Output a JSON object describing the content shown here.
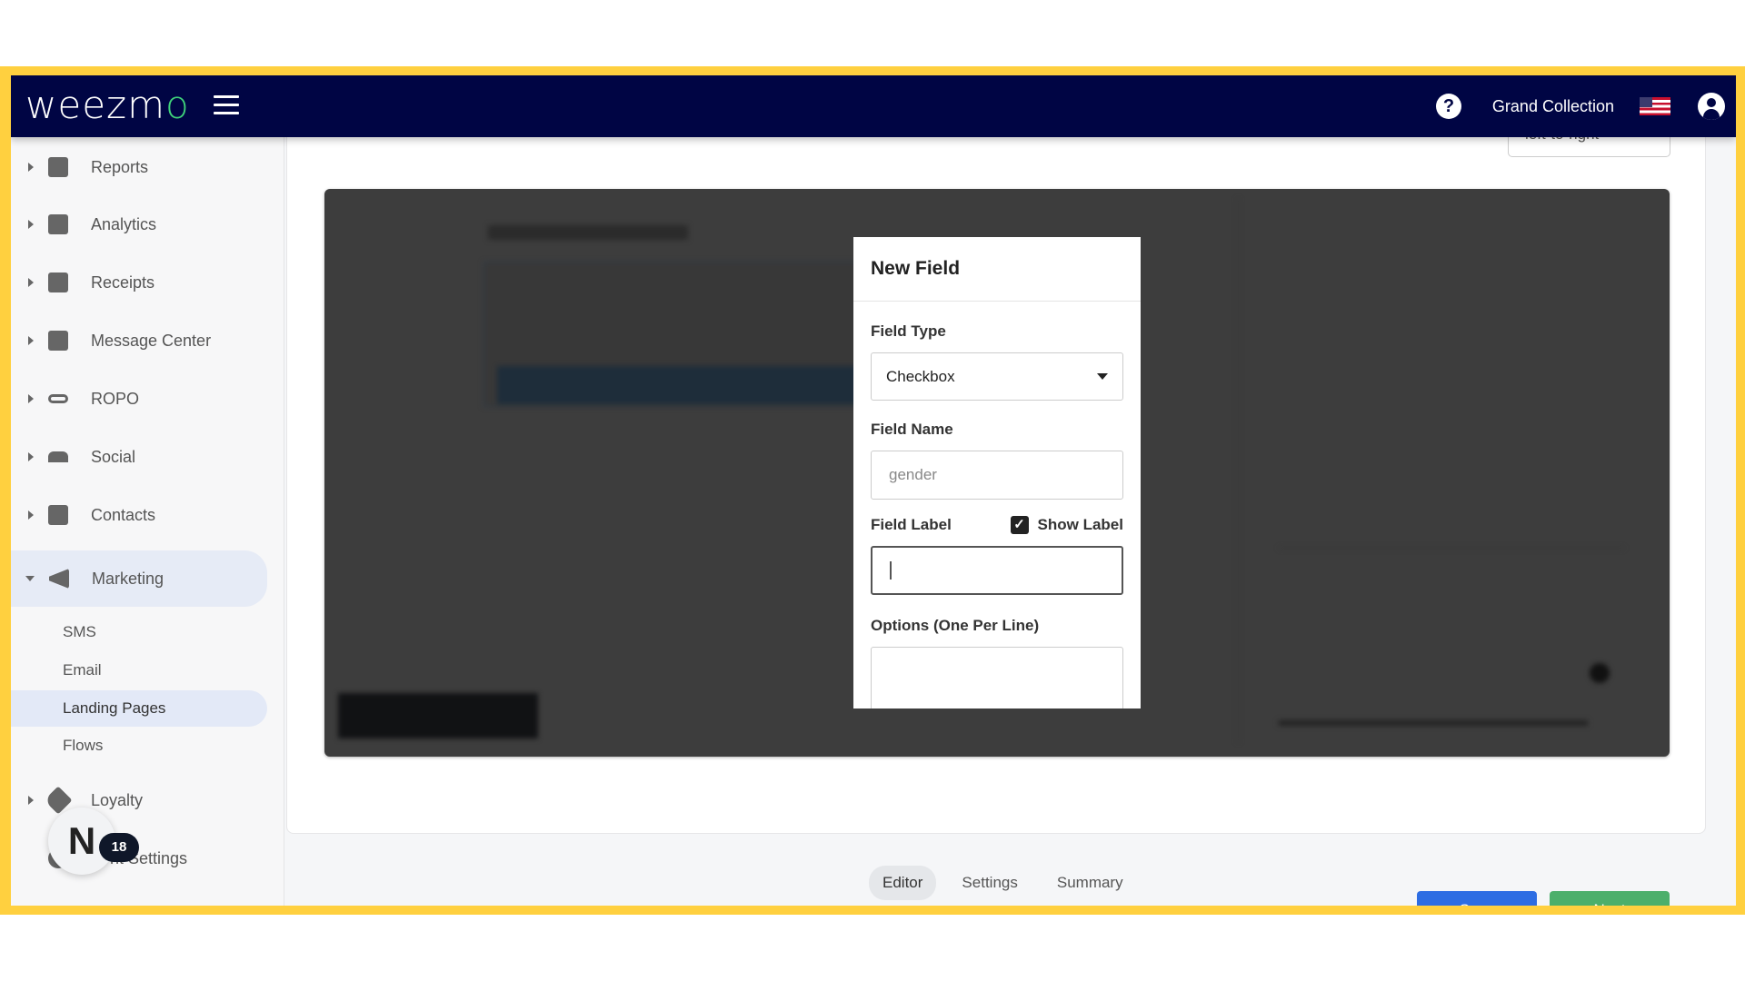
{
  "header": {
    "logo": "weezmo",
    "brand": "Grand Collection",
    "icons": [
      "menu-icon",
      "help-icon",
      "us-flag-icon",
      "user-icon"
    ]
  },
  "sidebar": {
    "items": [
      {
        "label": "Reports",
        "icon": "dashboard-icon"
      },
      {
        "label": "Analytics",
        "icon": "bar-chart-icon"
      },
      {
        "label": "Receipts",
        "icon": "receipt-icon"
      },
      {
        "label": "Message Center",
        "icon": "message-icon"
      },
      {
        "label": "ROPO",
        "icon": "infinity-icon"
      },
      {
        "label": "Social",
        "icon": "people-icon"
      },
      {
        "label": "Contacts",
        "icon": "contacts-icon"
      },
      {
        "label": "Marketing",
        "icon": "megaphone-icon",
        "expanded": true
      },
      {
        "label": "Loyalty",
        "icon": "tag-heart-icon"
      },
      {
        "label": "nt Settings",
        "icon": "gear-icon"
      }
    ],
    "subitems": [
      "SMS",
      "Email",
      "Landing Pages",
      "Flows"
    ],
    "active_subitem": "Landing Pages"
  },
  "notification": {
    "avatar": "N",
    "count": "18"
  },
  "main": {
    "direction": "left-to-right"
  },
  "modal": {
    "title": "New Field",
    "field_type_label": "Field Type",
    "field_type_value": "Checkbox",
    "field_name_label": "Field Name",
    "field_name_placeholder": "gender",
    "field_label_label": "Field Label",
    "show_label": "Show Label",
    "show_label_checked": true,
    "options_label": "Options (One Per Line)",
    "field_label_value": "",
    "options_value": ""
  },
  "tabs": [
    "Editor",
    "Settings",
    "Summary"
  ],
  "active_tab": "Editor",
  "buttons": {
    "save": "Save",
    "next": "Next"
  },
  "colors": {
    "header": "#000544",
    "frame": "#ffd03f",
    "save": "#2d6de3",
    "next": "#4caf6b",
    "logo_accent": "#3fd37a"
  }
}
